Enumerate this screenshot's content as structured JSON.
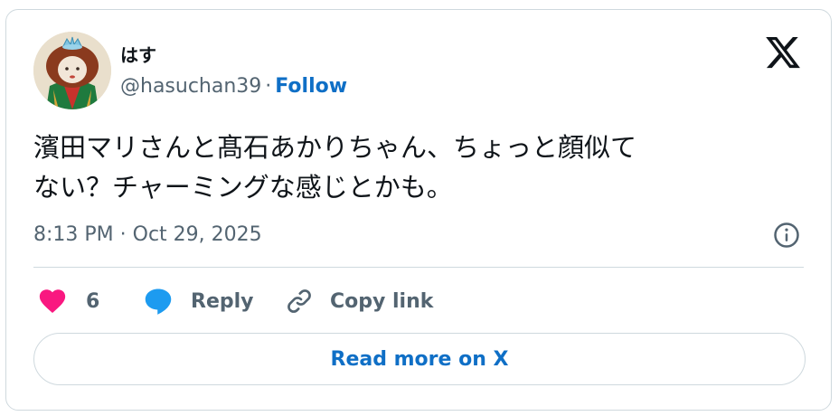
{
  "author": {
    "display_name": "はす",
    "handle": "@hasuchan39",
    "separator": "·",
    "follow_label": "Follow"
  },
  "tweet": {
    "text_line1": "濱田マリさんと髙石あかりちゃん、ちょっと顔似て",
    "text_line2": "ない？チャーミングな感じとかも。",
    "timestamp": "8:13 PM · Oct 29, 2025"
  },
  "actions": {
    "like_count": "6",
    "reply_label": "Reply",
    "copy_label": "Copy link"
  },
  "read_more_label": "Read more on X",
  "icons": {
    "brand": "x-logo-icon",
    "info": "info-icon",
    "like": "heart-icon",
    "reply": "speech-bubble-icon",
    "copy": "link-icon"
  },
  "colors": {
    "accent": "#0f6fc6",
    "like": "#f91880",
    "reply": "#1d9bf0",
    "muted": "#536471",
    "border": "#cfd9de"
  }
}
